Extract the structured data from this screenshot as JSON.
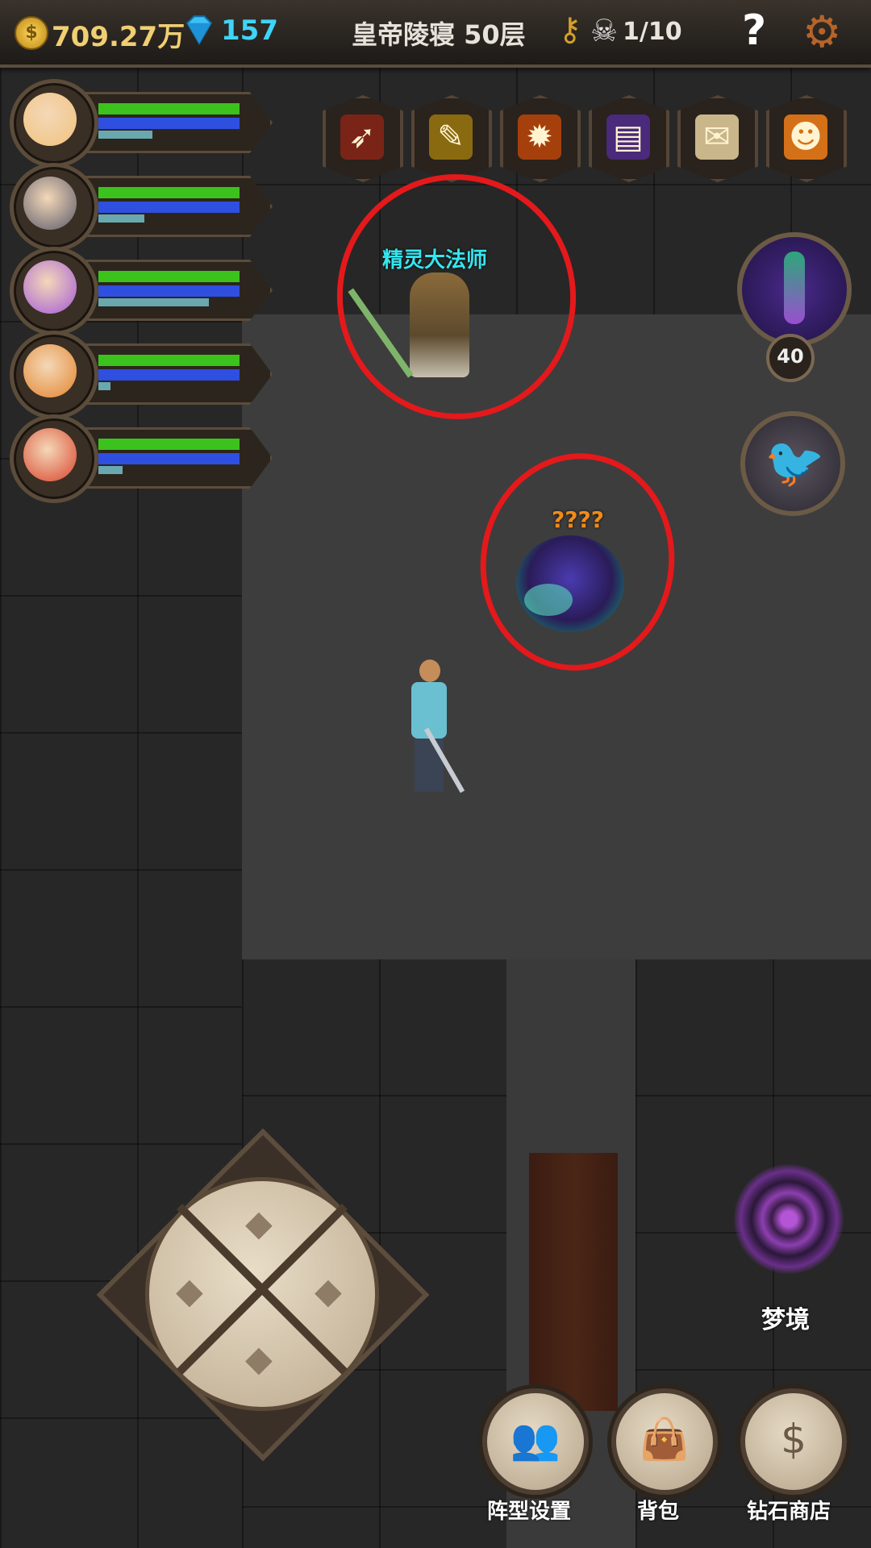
{
  "topbar": {
    "gold": "709.27万",
    "diamonds": "157",
    "location": "皇帝陵寝 50层",
    "kills": "1/10",
    "help": "?",
    "icons": {
      "gold": "coin-icon",
      "diamond": "gem-icon",
      "key": "key-icon",
      "skull": "skull-icon",
      "settings": "gear-icon"
    }
  },
  "party": [
    {
      "name": "hero-1",
      "hp": 0.92,
      "mp": 0.92,
      "xp": 0.35,
      "color": "#f1c27d"
    },
    {
      "name": "hero-2",
      "hp": 0.92,
      "mp": 0.92,
      "xp": 0.3,
      "color": "#5a5a6a"
    },
    {
      "name": "hero-3",
      "hp": 0.92,
      "mp": 0.92,
      "xp": 0.72,
      "color": "#a35ad6"
    },
    {
      "name": "hero-4",
      "hp": 0.92,
      "mp": 0.92,
      "xp": 0.08,
      "color": "#e2852e"
    },
    {
      "name": "hero-5",
      "hp": 0.92,
      "mp": 0.92,
      "xp": 0.16,
      "color": "#d9442c"
    }
  ],
  "skills": [
    "spear-icon",
    "feather-icon",
    "fire-orb-icon",
    "spellbook-icon",
    "scroll-icon",
    "pumpkin-icon"
  ],
  "companion": {
    "level": "40"
  },
  "npcs": {
    "mage_name": "精灵大法师",
    "unknown_name": "????"
  },
  "actions": {
    "dream": "梦境",
    "formation": "阵型设置",
    "bag": "背包",
    "shop": "钻石商店"
  },
  "colors": {
    "hp": "#3cc21c",
    "mp": "#2f4fe0",
    "xp": "#6aa8b0",
    "circle": "#e4191b"
  }
}
